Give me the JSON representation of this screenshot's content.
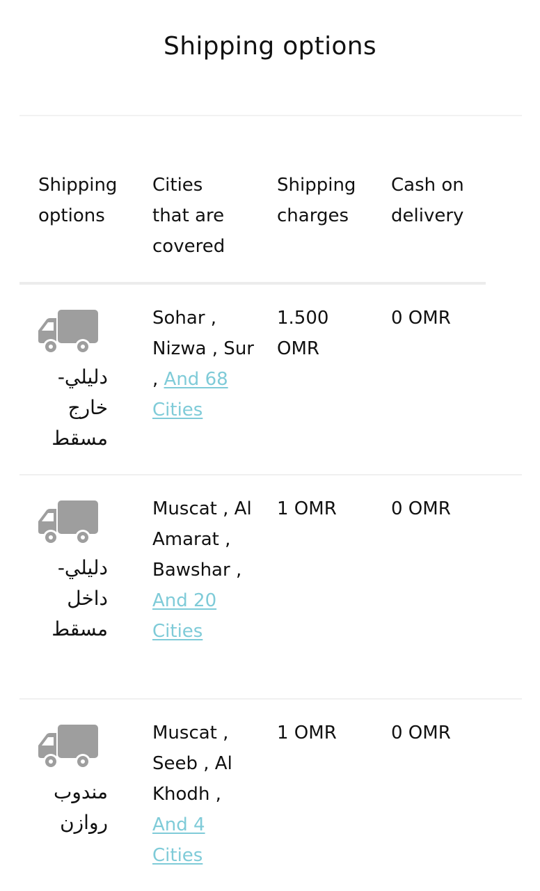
{
  "page": {
    "title": "Shipping options"
  },
  "table": {
    "headers": {
      "options": [
        "Shipping",
        "options"
      ],
      "cities": [
        "Cities",
        "that are",
        "covered"
      ],
      "charges": [
        "Shipping",
        "charges"
      ],
      "cod": [
        "Cash on",
        "delivery"
      ]
    },
    "rows": [
      {
        "icon": "truck-icon",
        "name": "دليلي- خارج مسقط",
        "cities_text": "Sohar , Nizwa , Sur , ",
        "more_link": "And 68 Cities",
        "charge": "1.500 OMR",
        "cod": "0 OMR"
      },
      {
        "icon": "truck-icon",
        "name": "دليلي- داخل مسقط",
        "cities_text": "Muscat , Al Amarat , Bawshar , ",
        "more_link": "And 20 Cities",
        "charge": "1 OMR",
        "cod": "0 OMR"
      },
      {
        "icon": "truck-icon",
        "name": "مندوب روازن",
        "cities_text": "Muscat , Seeb , Al Khodh , ",
        "more_link": "And 4 Cities",
        "charge": "1 OMR",
        "cod": "0 OMR"
      }
    ]
  },
  "colors": {
    "text": "#111111",
    "link": "#7fcbd8",
    "icon": "#9e9e9e",
    "divider": "#f0f0f0"
  }
}
